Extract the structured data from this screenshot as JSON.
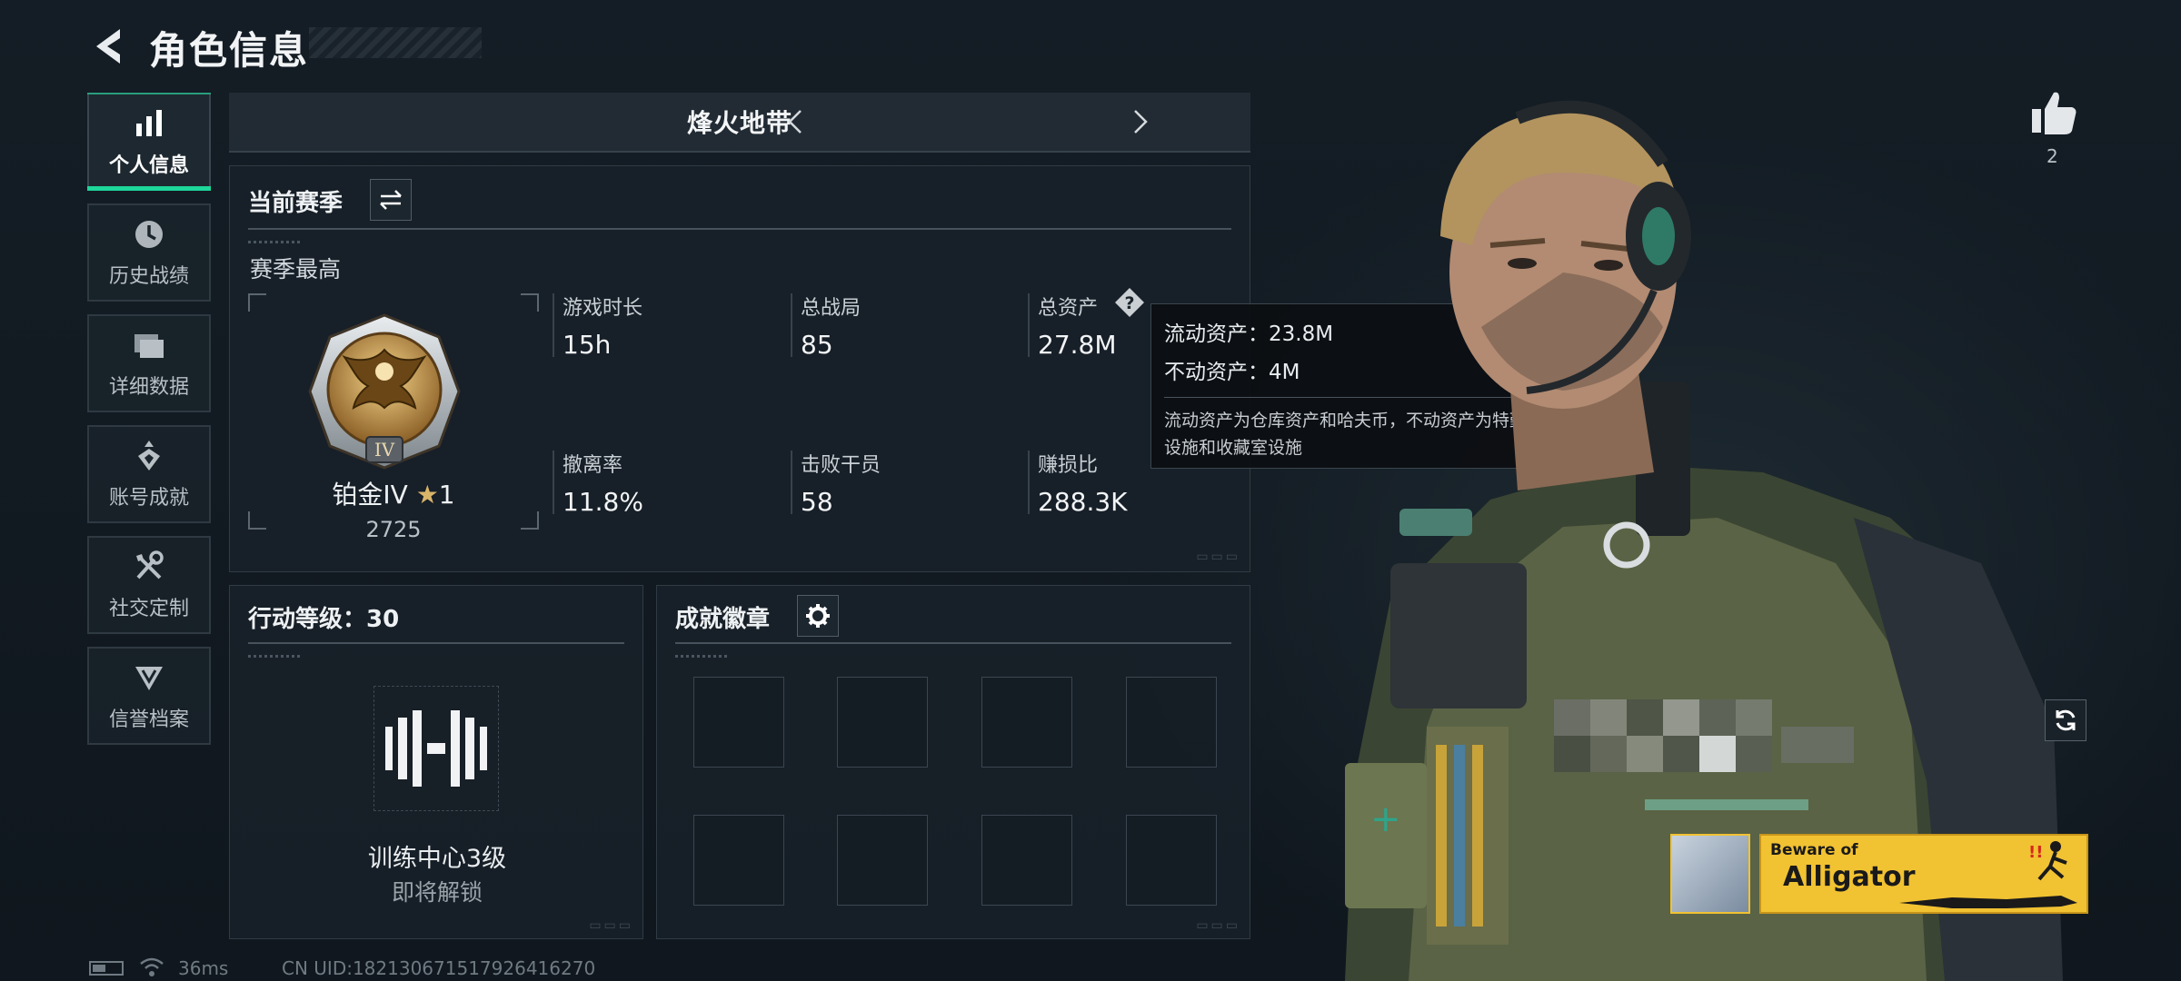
{
  "header": {
    "title": "角色信息"
  },
  "sidebar": {
    "items": [
      {
        "label": "个人信息",
        "icon": "bar-chart-icon",
        "active": true
      },
      {
        "label": "历史战绩",
        "icon": "clock-history-icon"
      },
      {
        "label": "详细数据",
        "icon": "folder-icon"
      },
      {
        "label": "账号成就",
        "icon": "achievement-icon"
      },
      {
        "label": "社交定制",
        "icon": "tools-icon"
      },
      {
        "label": "信誉档案",
        "icon": "shield-badge-icon"
      }
    ]
  },
  "mode_bar": {
    "name": "烽火地带"
  },
  "season": {
    "heading": "当前赛季",
    "best_label": "赛季最高",
    "rank": {
      "name": "铂金IV",
      "stars": "1",
      "score": "2725",
      "emblem_numeral": "IV"
    },
    "stats": [
      {
        "label": "游戏时长",
        "value": "15h"
      },
      {
        "label": "总战局",
        "value": "85"
      },
      {
        "label": "总资产",
        "value": "27.8M"
      },
      {
        "label": "撤离率",
        "value": "11.8%"
      },
      {
        "label": "击败干员",
        "value": "58"
      },
      {
        "label": "赚损比",
        "value": "288.3K"
      }
    ]
  },
  "tooltip": {
    "line1": "流动资产：23.8M",
    "line2": "不动资产：4M",
    "note_line1": "流动资产为仓库资产和哈夫币，不动资产为特勤处",
    "note_line2": "设施和收藏室设施"
  },
  "action_level": {
    "heading": "行动等级：30",
    "unlock_name": "训练中心3级",
    "unlock_status": "即将解锁"
  },
  "achievements": {
    "heading": "成就徽章",
    "slot_count": 8
  },
  "likes": {
    "count": "2"
  },
  "banner": {
    "line1": "Beware of",
    "line2": "Alligator"
  },
  "footer": {
    "ping": "36ms",
    "uid": "CN UID:18213067151792​6416270"
  },
  "colors": {
    "accent": "#1ed79a",
    "tooltip_bg": "#0c0e11",
    "banner_bg": "#f1c232"
  }
}
